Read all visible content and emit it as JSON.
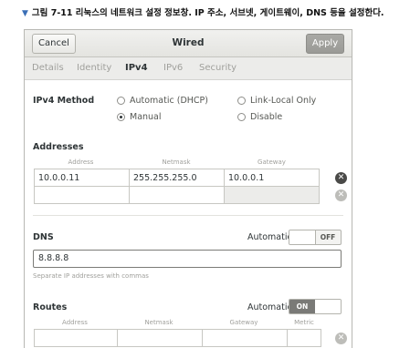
{
  "caption": "그림 7-11 리눅스의 네트워크 설정 정보창. IP 주소, 서브넷, 게이트웨이, DNS 등을 설정한다.",
  "header": {
    "cancel": "Cancel",
    "title": "Wired",
    "apply": "Apply"
  },
  "tabs": [
    {
      "label": "Details",
      "active": false
    },
    {
      "label": "Identity",
      "active": false
    },
    {
      "label": "IPv4",
      "active": true
    },
    {
      "label": "IPv6",
      "active": false
    },
    {
      "label": "Security",
      "active": false
    }
  ],
  "ipv4_method": {
    "label": "IPv4 Method",
    "options": [
      {
        "label": "Automatic (DHCP)",
        "selected": false
      },
      {
        "label": "Link-Local Only",
        "selected": false
      },
      {
        "label": "Manual",
        "selected": true
      },
      {
        "label": "Disable",
        "selected": false
      }
    ]
  },
  "addresses": {
    "label": "Addresses",
    "columns": [
      "Address",
      "Netmask",
      "Gateway"
    ],
    "rows": [
      [
        "10.0.0.11",
        "255.255.255.0",
        "10.0.0.1"
      ],
      [
        "",
        "",
        ""
      ]
    ]
  },
  "dns": {
    "label": "DNS",
    "automatic_label": "Automatic",
    "toggle": "OFF",
    "value": "8.8.8.8",
    "hint": "Separate IP addresses with commas"
  },
  "routes": {
    "label": "Routes",
    "automatic_label": "Automatic",
    "toggle": "ON",
    "columns": [
      "Address",
      "Netmask",
      "Gateway",
      "Metric"
    ]
  },
  "colors": {
    "toggle_on": "#7a7a77",
    "apply_bg": "#a3a39f"
  }
}
